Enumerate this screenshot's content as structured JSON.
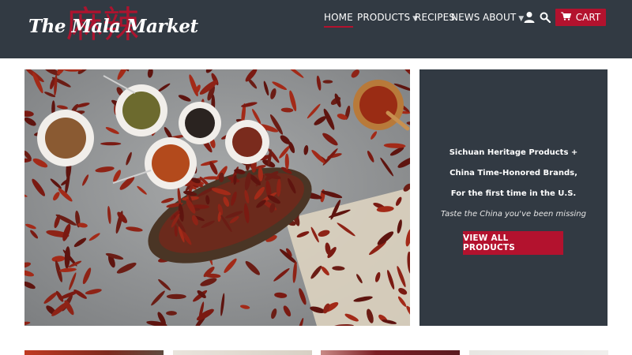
{
  "brand": {
    "name": "The Mala Market",
    "glyph": "麻辣"
  },
  "nav": {
    "home": "HOME",
    "products": "PRODUCTS",
    "recipes": "RECIPES",
    "news": "NEWS",
    "about": "ABOUT",
    "cart": "CART",
    "dropdown_icon": "caret-down-icon",
    "account_icon": "user-icon",
    "search_icon": "search-icon",
    "cart_icon": "cart-icon"
  },
  "hero": {
    "image_icon": "dried-chili-peppers-photo"
  },
  "promo": {
    "line1": "Sichuan Heritage Products +",
    "line2": "China Time-Honored Brands,",
    "line3": "For the first time in the U.S.",
    "tagline": "Taste the China you've been missing",
    "button": "VIEW ALL PRODUCTS"
  },
  "colors": {
    "header_bg": "#323a43",
    "accent_red": "#b3122e",
    "promo_bg": "#323a43"
  }
}
